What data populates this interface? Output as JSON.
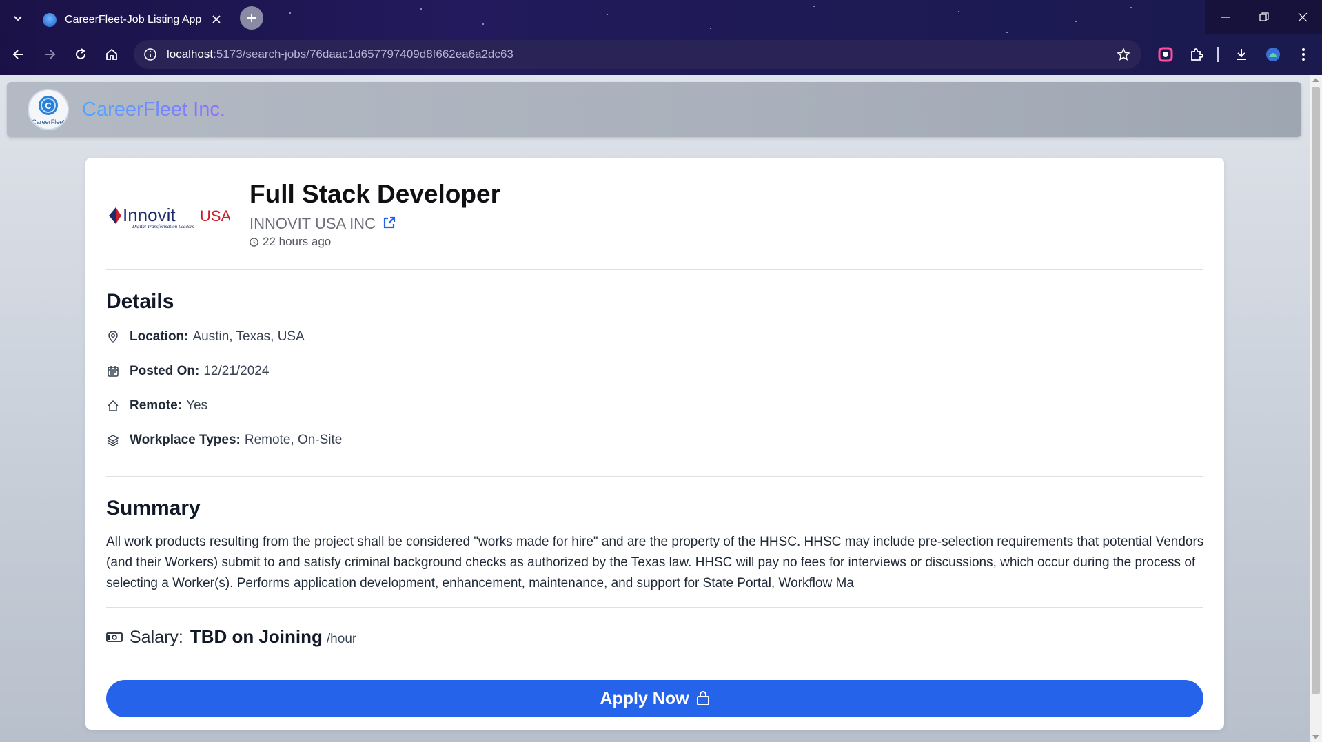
{
  "browser": {
    "tab_title": "CareerFleet-Job Listing App",
    "url_host": "localhost",
    "url_path": ":5173/search-jobs/76daac1d657797409d8f662ea6a2dc63"
  },
  "navbar": {
    "brand_name": "CareerFleet Inc.",
    "logo_text": "CareerFleet"
  },
  "job": {
    "title": "Full Stack Developer",
    "company": "INNOVIT USA INC",
    "company_logo_text": "Innovit",
    "company_logo_text2": "USA",
    "company_logo_tagline": "Digital Transformation Leaders",
    "posted_ago": "22 hours ago"
  },
  "details": {
    "heading": "Details",
    "location_label": "Location:",
    "location_value": "Austin, Texas, USA",
    "posted_label": "Posted On:",
    "posted_value": "12/21/2024",
    "remote_label": "Remote:",
    "remote_value": "Yes",
    "workplace_label": "Workplace Types:",
    "workplace_value": "Remote, On-Site"
  },
  "summary": {
    "heading": "Summary",
    "text": "All work products resulting from the project shall be considered \"works made for hire\" and are the property of the HHSC. HHSC may include pre-selection requirements that potential Vendors (and their Workers) submit to and satisfy criminal background checks as authorized by the Texas law. HHSC will pay no fees for interviews or discussions, which occur during the process of selecting a Worker(s). Performs application development, enhancement, maintenance, and support for State Portal, Workflow Ma"
  },
  "salary": {
    "label": "Salary:",
    "value": "TBD on Joining",
    "unit": "/hour"
  },
  "actions": {
    "apply_label": "Apply Now"
  },
  "colors": {
    "accent": "#2563eb",
    "brand_gradient_start": "#4fa7ff",
    "brand_gradient_end": "#8f6cff"
  }
}
